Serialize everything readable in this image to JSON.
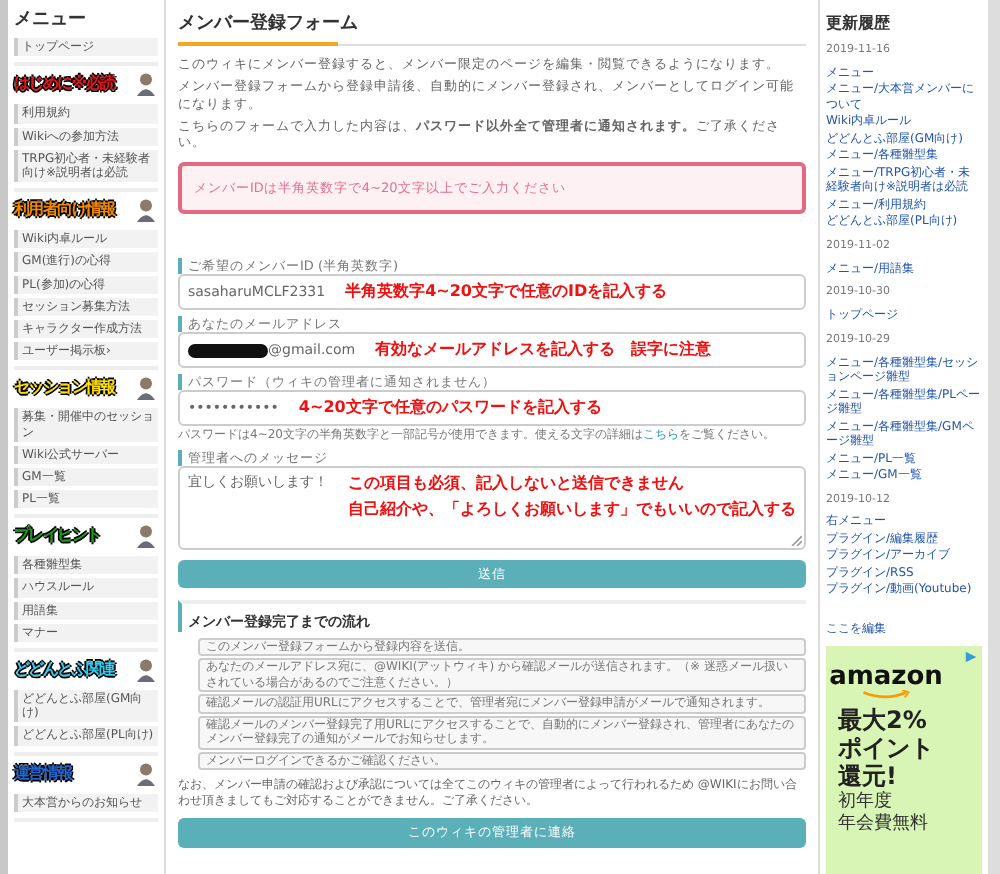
{
  "left_menu": {
    "title": "メニュー",
    "sections": [
      {
        "items": [
          "トップページ"
        ]
      },
      {
        "heading": "はじめに※必読",
        "color": "#e8141b",
        "items": [
          "利用規約",
          "Wikiへの参加方法",
          "TRPG初心者・未経験者向け※説明者は必読"
        ]
      },
      {
        "heading": "利用者向け情報",
        "color": "#f08a00",
        "items": [
          "Wiki内卓ルール",
          "GM(進行)の心得",
          "PL(参加)の心得",
          "セッション募集方法",
          "キャラクター作成方法",
          "ユーザー掲示板›"
        ]
      },
      {
        "heading": "セッション情報",
        "color": "#ffe000",
        "items": [
          "募集・開催中のセッション",
          "Wiki公式サーバー",
          "GM一覧",
          "PL一覧"
        ]
      },
      {
        "heading": "プレイヒント",
        "color": "#1a9a1a",
        "items": [
          "各種雛型集",
          "ハウスルール",
          "用語集",
          "マナー"
        ]
      },
      {
        "heading": "どどんとふ関連",
        "color": "#33ccee",
        "items": [
          "どどんとふ部屋(GM向け)",
          "どどんとふ部屋(PL向け)"
        ]
      },
      {
        "heading": "運営情報",
        "color": "#2266cc",
        "items": [
          "大本営からのお知らせ"
        ]
      }
    ]
  },
  "main": {
    "title": "メンバー登録フォーム",
    "intro": [
      "このウィキにメンバー登録すると、メンバー限定のページを編集・閲覧できるようになります。",
      "メンバー登録フォームから登録申請後、自動的にメンバー登録され、メンバーとしてログイン可能になります。",
      "こちらのフォームで入力した内容は、**パスワード以外全て管理者に通知されます。**ご了承ください。"
    ],
    "error": "メンバーIDは半角英数字で4~20文字以上でご入力ください",
    "fields": [
      {
        "kind": "text",
        "label": "ご希望のメンバーID (半角英数字)",
        "value": "sasaharuMCLF2331",
        "redacted": false,
        "notes": [
          "半角英数字4~20文字で任意のIDを記入する"
        ]
      },
      {
        "kind": "text",
        "label": "あなたのメールアドレス",
        "value": "@gmail.com",
        "redacted": true,
        "notes": [
          "有効なメールアドレスを記入する　誤字に注意"
        ]
      },
      {
        "kind": "text",
        "label": "パスワード（ウィキの管理者に通知されません）",
        "value": "•••••••••••",
        "redacted": false,
        "notes": [
          "4~20文字で任意のパスワードを記入する"
        ],
        "hint": {
          "before": "パスワードは4~20文字の半角英数字と一部記号が使用できます。使える文字の詳細は",
          "link": "こちら",
          "after": "をご覧ください。"
        }
      },
      {
        "kind": "textarea",
        "label": "管理者へのメッセージ",
        "value": "宜しくお願いします！",
        "redacted": false,
        "notes": [
          "この項目も必須、記入しないと送信できません",
          "自己紹介や、「よろしくお願いします」でもいいので記入する"
        ]
      }
    ],
    "submit": "送信",
    "flow_title": "メンバー登録完了までの流れ",
    "steps": [
      "このメンバー登録フォームから登録内容を送信。",
      "あなたのメールアドレス宛に、@WIKI(アットウィキ) から確認メールが送信されます。（※ 迷惑メール扱いされている場合があるのでご注意ください。）",
      "確認メールの認証用URLにアクセスすることで、管理者宛にメンバー登録申請がメールで通知されます。",
      "確認メールのメンバー登録完了用URLにアクセスすることで、自動的にメンバー登録され、管理者にあなたのメンバー登録完了の通知がメールでお知らせします。",
      "メンバーログインできるかご確認ください。"
    ],
    "note": "なお、メンバー申請の確認および承認については全てこのウィキの管理者によって行われるため @WIKIにお問い合わせ頂きましてもご対応することができません。ご了承ください。",
    "contact": "このウィキの管理者に連絡"
  },
  "right_sidebar": {
    "title": "更新履歴",
    "groups": [
      {
        "date": "2019-11-16",
        "items": [
          "メニュー",
          "メニュー/大本営メンバーについて",
          "Wiki内卓ルール",
          "どどんとふ部屋(GM向け)",
          "メニュー/各種雛型集",
          "メニュー/TRPG初心者・未経験者向け※説明者は必読",
          "メニュー/利用規約",
          "どどんとふ部屋(PL向け)"
        ]
      },
      {
        "date": "2019-11-02",
        "items": [
          "メニュー/用語集"
        ]
      },
      {
        "date": "2019-10-30",
        "items": [
          "トップページ"
        ]
      },
      {
        "date": "2019-10-29",
        "items": [
          "メニュー/各種雛型集/セッションページ雛型",
          "メニュー/各種雛型集/PLページ雛型",
          "メニュー/各種雛型集/GMページ雛型",
          "メニュー/PL一覧",
          "メニュー/GM一覧"
        ]
      },
      {
        "date": "2019-10-12",
        "items": [
          "右メニュー",
          "プラグイン/編集履歴",
          "プラグイン/アーカイブ",
          "プラグイン/RSS",
          "プラグイン/動画(Youtube)"
        ]
      }
    ],
    "edit_link": "ここを編集",
    "ad": {
      "logo": "amazon",
      "headline": [
        "最大2%",
        "ポイント",
        "還元!"
      ],
      "subline": [
        "初年度",
        "年会費無料"
      ]
    }
  }
}
